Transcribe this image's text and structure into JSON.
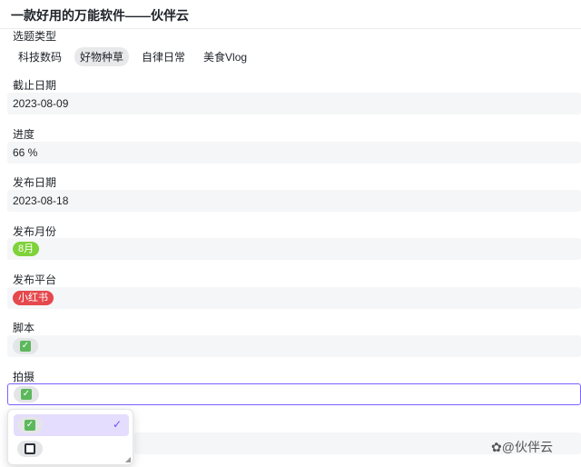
{
  "header": {
    "title": "一款好用的万能软件——伙伴云",
    "caret": "⌄"
  },
  "fields": {
    "topic_type": {
      "label": "选题类型",
      "options": [
        "科技数码",
        "好物种草",
        "自律日常",
        "美食Vlog"
      ],
      "active_index": 1
    },
    "deadline": {
      "label": "截止日期",
      "value": "2023-08-09"
    },
    "progress": {
      "label": "进度",
      "value": "66 %"
    },
    "publish_date": {
      "label": "发布日期",
      "value": "2023-08-18"
    },
    "publish_month": {
      "label": "发布月份",
      "value": "8月",
      "color": "#7fd23a"
    },
    "platform": {
      "label": "发布平台",
      "value": "小红书",
      "color": "#e5484d"
    },
    "script": {
      "label": "脚本",
      "value": "checked"
    },
    "shoot": {
      "label": "拍摄",
      "value": "checked"
    }
  },
  "dropdown": {
    "options": [
      {
        "name": "checked",
        "selected": true
      },
      {
        "name": "unchecked",
        "selected": false
      }
    ],
    "tick": "✓"
  },
  "watermark": "伙伴云",
  "accent": "#7b61ff"
}
